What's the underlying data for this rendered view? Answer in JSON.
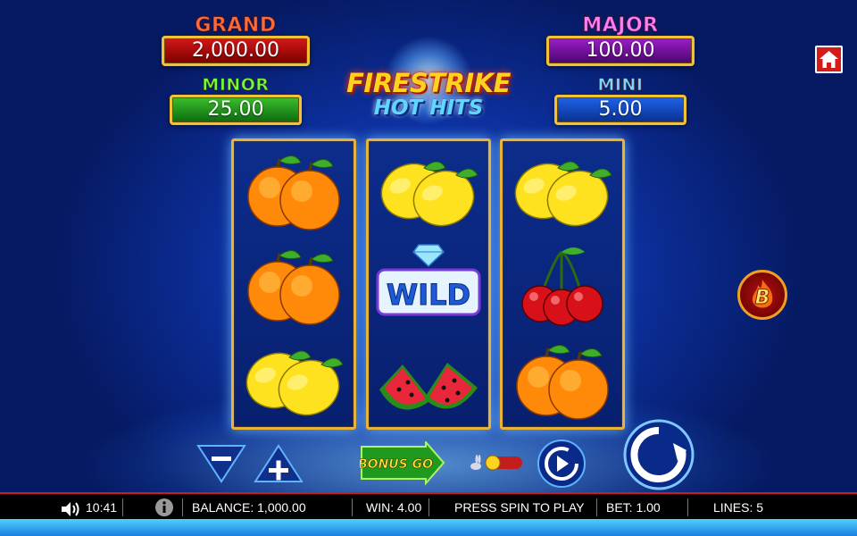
{
  "jackpots": {
    "grand": {
      "label": "GRAND",
      "value": "2,000.00"
    },
    "minor": {
      "label": "MINOR",
      "value": "25.00"
    },
    "major": {
      "label": "MAJOR",
      "value": "100.00"
    },
    "mini": {
      "label": "MINI",
      "value": "5.00"
    }
  },
  "logo": {
    "line1": "FIRESTRIKE",
    "line2": "HOT HITS"
  },
  "reels": [
    [
      "oranges",
      "oranges",
      "lemons"
    ],
    [
      "lemons",
      "wild",
      "watermelon"
    ],
    [
      "lemons",
      "cherries",
      "oranges"
    ]
  ],
  "wild_text": "WILD",
  "bonus_button": {
    "label": "BONUS GO",
    "badge": "B"
  },
  "status_bar": {
    "time": "10:41",
    "balance": "BALANCE: 1,000.00",
    "win": "WIN: 4.00",
    "message": "PRESS SPIN TO PLAY",
    "bet": "BET: 1.00",
    "lines": "LINES: 5"
  },
  "icons": {
    "home": "home-icon",
    "sound": "speaker-icon",
    "info": "info-icon",
    "turbo": "rabbit-icon",
    "autoplay": "autoplay-icon",
    "spin": "spin-icon"
  },
  "colors": {
    "reel_border": "#e9b33a",
    "status_accent": "#d11a1a",
    "background": "#0c2f9c"
  }
}
